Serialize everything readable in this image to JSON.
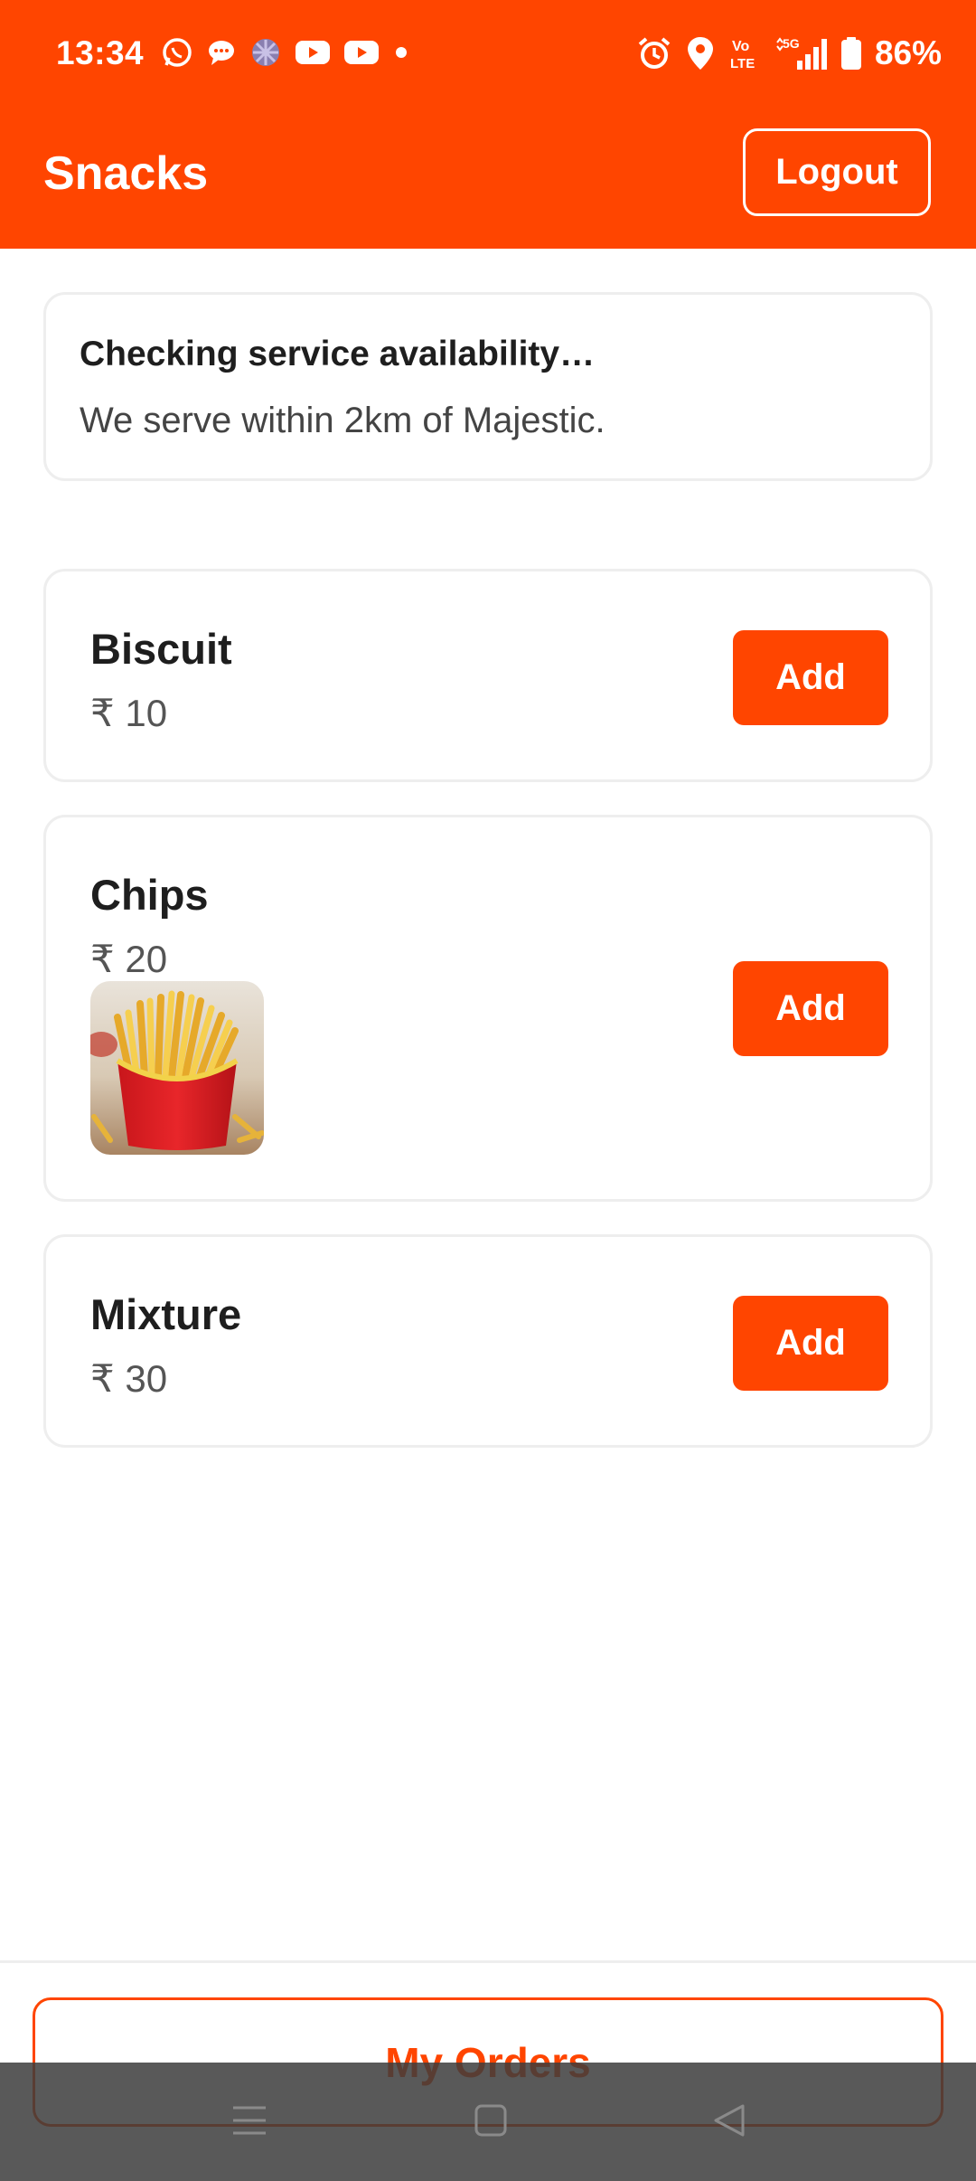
{
  "status_bar": {
    "time": "13:34",
    "battery": "86%",
    "left_icons": [
      "whatsapp-icon",
      "chat-icon",
      "pinwheel-icon",
      "youtube-icon",
      "youtube-icon",
      "dot-icon"
    ],
    "right_icons": [
      "alarm-icon",
      "location-icon",
      "volte-icon",
      "signal-5g-icon",
      "battery-icon"
    ]
  },
  "header": {
    "title": "Snacks",
    "logout_label": "Logout"
  },
  "notice": {
    "title": "Checking service availability…",
    "text": "We serve within 2km of Majestic."
  },
  "products": [
    {
      "name": "Biscuit",
      "price": "₹ 10",
      "add_label": "Add"
    },
    {
      "name": "Chips",
      "price": "₹ 20",
      "add_label": "Add",
      "image": "french-fries"
    },
    {
      "name": "Mixture",
      "price": "₹ 30",
      "add_label": "Add"
    }
  ],
  "footer": {
    "orders_label": "My Orders"
  },
  "nav": {
    "icons": [
      "menu-icon",
      "home-icon",
      "back-icon"
    ]
  },
  "colors": {
    "accent": "#ff4500",
    "text": "#1e1e1e",
    "muted": "#555555",
    "border": "#eeeeee"
  }
}
